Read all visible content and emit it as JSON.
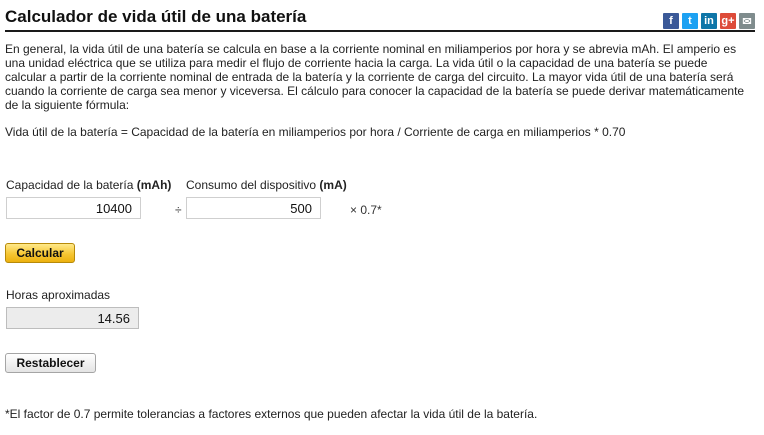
{
  "title": "Calculador de vida útil de una batería",
  "social": [
    {
      "icon": "facebook-icon",
      "glyph": "f",
      "color": "#3b5998"
    },
    {
      "icon": "twitter-icon",
      "glyph": "t",
      "color": "#1da1f2"
    },
    {
      "icon": "linkedin-icon",
      "glyph": "in",
      "color": "#0e76a8"
    },
    {
      "icon": "google-plus-icon",
      "glyph": "g+",
      "color": "#dd4b39"
    },
    {
      "icon": "email-icon",
      "glyph": "✉",
      "color": "#7f8c8d"
    }
  ],
  "intro": "En general, la vida útil de una batería se calcula en base a la corriente nominal en miliamperios por hora y se abrevia mAh. El amperio es una unidad eléctrica que se utiliza para medir el flujo de corriente hacia la carga. La vida útil o la capacidad de una batería se puede calcular a partir de la corriente nominal de entrada de la batería y la corriente de carga del circuito. La mayor vida útil de una batería será cuando la corriente de carga sea menor y viceversa. El cálculo para conocer la capacidad de la batería se puede derivar matemáticamente de la siguiente fórmula:",
  "formula": "Vida útil de la batería = Capacidad de la batería en miliamperios por hora / Corriente de carga en miliamperios * 0.70",
  "capacity": {
    "label": "Capacidad de la batería ",
    "unit": "(mAh)",
    "value": "10400"
  },
  "divide_symbol": "÷",
  "consumption": {
    "label": "Consumo del dispositivo ",
    "unit": "(mA)",
    "value": "500"
  },
  "factor_text": "× 0.7*",
  "calculate_label": "Calcular",
  "result": {
    "label": "Horas aproximadas",
    "value": "14.56"
  },
  "reset_label": "Restablecer",
  "footnote": "*El factor de 0.7 permite tolerancias a factores externos que pueden afectar la vida útil de la batería."
}
